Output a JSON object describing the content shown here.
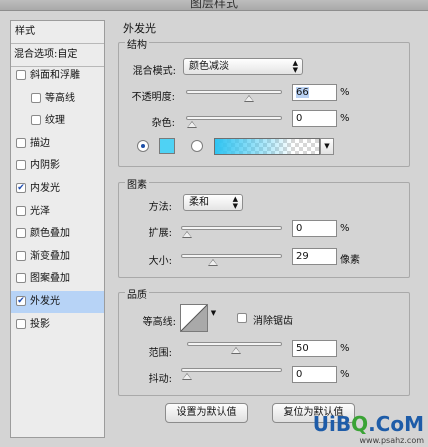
{
  "window": {
    "title": "图层样式"
  },
  "left_panel": {
    "header": "样式",
    "blend_options": "混合选项:自定",
    "items": [
      {
        "label": "斜面和浮雕",
        "checked": false,
        "indent": 0,
        "active": false
      },
      {
        "label": "等高线",
        "checked": false,
        "indent": 1,
        "active": false
      },
      {
        "label": "纹理",
        "checked": false,
        "indent": 1,
        "active": false
      },
      {
        "label": "描边",
        "checked": false,
        "indent": 0,
        "active": false
      },
      {
        "label": "内阴影",
        "checked": false,
        "indent": 0,
        "active": false
      },
      {
        "label": "内发光",
        "checked": true,
        "indent": 0,
        "active": false
      },
      {
        "label": "光泽",
        "checked": false,
        "indent": 0,
        "active": false
      },
      {
        "label": "颜色叠加",
        "checked": false,
        "indent": 0,
        "active": false
      },
      {
        "label": "渐变叠加",
        "checked": false,
        "indent": 0,
        "active": false
      },
      {
        "label": "图案叠加",
        "checked": false,
        "indent": 0,
        "active": false
      },
      {
        "label": "外发光",
        "checked": true,
        "indent": 0,
        "active": true
      },
      {
        "label": "投影",
        "checked": false,
        "indent": 0,
        "active": false
      }
    ],
    "check_glyph": "✔"
  },
  "main": {
    "section_title": "外发光",
    "structure": {
      "title": "结构",
      "blend_mode_label": "混合模式:",
      "blend_mode_value": "颜色减淡",
      "opacity_label": "不透明度:",
      "opacity_value": "66",
      "opacity_level": 66,
      "noise_label": "杂色:",
      "noise_value": "0",
      "noise_level": 0,
      "unit": "%",
      "color": "#4fd2f4"
    },
    "elements": {
      "title": "图素",
      "method_label": "方法:",
      "method_value": "柔和",
      "spread_label": "扩展:",
      "spread_value": "0",
      "spread_level": 0,
      "size_label": "大小:",
      "size_value": "29",
      "size_level": 29,
      "unit": "%",
      "size_unit": "像素"
    },
    "quality": {
      "title": "品质",
      "contour_label": "等高线:",
      "anti_alias_label": "消除锯齿",
      "range_label": "范围:",
      "range_value": "50",
      "range_level": 50,
      "jitter_label": "抖动:",
      "jitter_value": "0",
      "jitter_level": 0,
      "unit": "%"
    },
    "buttons": {
      "set_default": "设置为默认值",
      "reset_default": "复位为默认值"
    }
  },
  "watermark": {
    "logo_left": "UiB",
    "logo_o": "Q",
    "logo_right": ".CoM",
    "site": "www.psahz.com"
  }
}
